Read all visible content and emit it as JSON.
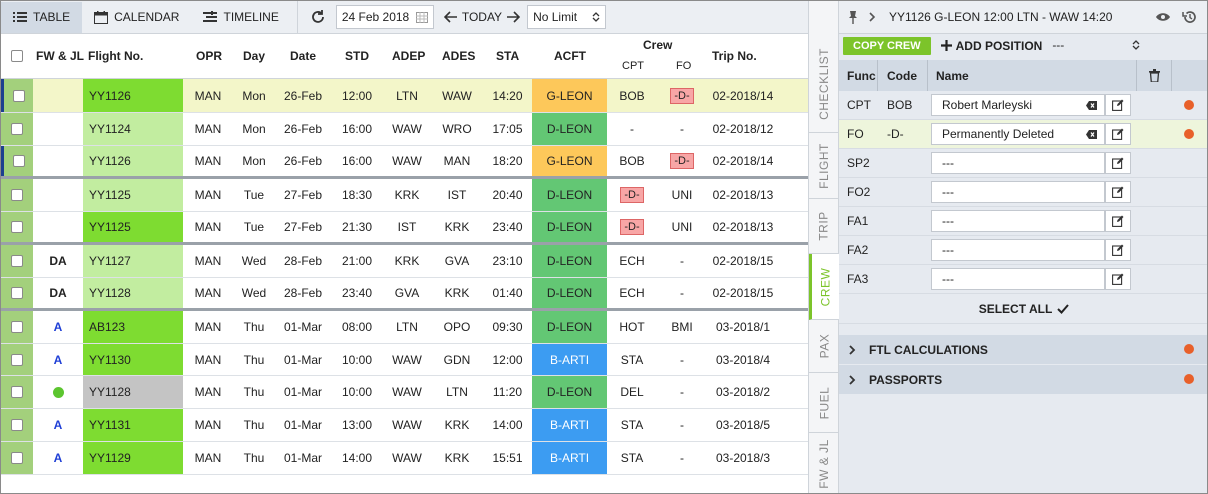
{
  "toolbar": {
    "table": "TABLE",
    "calendar": "CALENDAR",
    "timeline": "TIMELINE",
    "date": "24 Feb 2018",
    "today": "TODAY",
    "limit": "No Limit"
  },
  "columns": {
    "fwjl": "FW & JL",
    "flight": "Flight No.",
    "opr": "OPR",
    "day": "Day",
    "date": "Date",
    "std": "STD",
    "adep": "ADEP",
    "ades": "ADES",
    "sta": "STA",
    "acft": "ACFT",
    "crew": "Crew",
    "cpt": "CPT",
    "fo": "FO",
    "trip": "Trip No."
  },
  "rows": [
    {
      "fw": "",
      "flight": "YY1126",
      "opr": "MAN",
      "day": "Mon",
      "date": "26-Feb",
      "std": "12:00",
      "adep": "LTN",
      "ades": "WAW",
      "sta": "14:20",
      "acft": "G-LEON",
      "cpt": "BOB",
      "fo": "-D-",
      "trip": "02-2018/14"
    },
    {
      "fw": "",
      "flight": "YY1124",
      "opr": "MAN",
      "day": "Mon",
      "date": "26-Feb",
      "std": "16:00",
      "adep": "WAW",
      "ades": "WRO",
      "sta": "17:05",
      "acft": "D-LEON",
      "cpt": "-",
      "fo": "-",
      "trip": "02-2018/12"
    },
    {
      "fw": "",
      "flight": "YY1126",
      "opr": "MAN",
      "day": "Mon",
      "date": "26-Feb",
      "std": "16:00",
      "adep": "WAW",
      "ades": "MAN",
      "sta": "18:20",
      "acft": "G-LEON",
      "cpt": "BOB",
      "fo": "-D-",
      "trip": "02-2018/14"
    },
    {
      "fw": "",
      "flight": "YY1125",
      "opr": "MAN",
      "day": "Tue",
      "date": "27-Feb",
      "std": "18:30",
      "adep": "KRK",
      "ades": "IST",
      "sta": "20:40",
      "acft": "D-LEON",
      "cpt": "-D-",
      "fo": "UNI",
      "trip": "02-2018/13"
    },
    {
      "fw": "",
      "flight": "YY1125",
      "opr": "MAN",
      "day": "Tue",
      "date": "27-Feb",
      "std": "21:30",
      "adep": "IST",
      "ades": "KRK",
      "sta": "23:40",
      "acft": "D-LEON",
      "cpt": "-D-",
      "fo": "UNI",
      "trip": "02-2018/13"
    },
    {
      "fw": "DA",
      "flight": "YY1127",
      "opr": "MAN",
      "day": "Wed",
      "date": "28-Feb",
      "std": "21:00",
      "adep": "KRK",
      "ades": "GVA",
      "sta": "23:10",
      "acft": "D-LEON",
      "cpt": "ECH",
      "fo": "-",
      "trip": "02-2018/15"
    },
    {
      "fw": "DA",
      "flight": "YY1128",
      "opr": "MAN",
      "day": "Wed",
      "date": "28-Feb",
      "std": "23:40",
      "adep": "GVA",
      "ades": "KRK",
      "sta": "01:40",
      "acft": "D-LEON",
      "cpt": "ECH",
      "fo": "-",
      "trip": "02-2018/15"
    },
    {
      "fw": "A",
      "flight": "AB123",
      "opr": "MAN",
      "day": "Thu",
      "date": "01-Mar",
      "std": "08:00",
      "adep": "LTN",
      "ades": "OPO",
      "sta": "09:30",
      "acft": "D-LEON",
      "cpt": "HOT",
      "fo": "BMI",
      "trip": "03-2018/1"
    },
    {
      "fw": "A",
      "flight": "YY1130",
      "opr": "MAN",
      "day": "Thu",
      "date": "01-Mar",
      "std": "10:00",
      "adep": "WAW",
      "ades": "GDN",
      "sta": "12:00",
      "acft": "B-ARTI",
      "cpt": "STA",
      "fo": "-",
      "trip": "03-2018/4"
    },
    {
      "fw": "",
      "flight": "YY1128",
      "opr": "MAN",
      "day": "Thu",
      "date": "01-Mar",
      "std": "10:00",
      "adep": "WAW",
      "ades": "LTN",
      "sta": "11:20",
      "acft": "D-LEON",
      "cpt": "DEL",
      "fo": "-",
      "trip": "03-2018/2"
    },
    {
      "fw": "A",
      "flight": "YY1131",
      "opr": "MAN",
      "day": "Thu",
      "date": "01-Mar",
      "std": "13:00",
      "adep": "WAW",
      "ades": "KRK",
      "sta": "14:00",
      "acft": "B-ARTI",
      "cpt": "STA",
      "fo": "-",
      "trip": "03-2018/5"
    },
    {
      "fw": "A",
      "flight": "YY1129",
      "opr": "MAN",
      "day": "Thu",
      "date": "01-Mar",
      "std": "14:00",
      "adep": "WAW",
      "ades": "KRK",
      "sta": "15:51",
      "acft": "B-ARTI",
      "cpt": "STA",
      "fo": "-",
      "trip": "03-2018/3"
    }
  ],
  "side_tabs": [
    "CHECKLIST",
    "FLIGHT",
    "TRIP",
    "CREW",
    "PAX",
    "FUEL",
    "FW & JL"
  ],
  "panel": {
    "title": "YY1126 G-LEON 12:00 LTN - WAW 14:20",
    "copy_crew": "COPY CREW",
    "add_position": "ADD POSITION",
    "position_select": "---",
    "hdr_func": "Func",
    "hdr_code": "Code",
    "hdr_name": "Name",
    "crew": [
      {
        "func": "CPT",
        "code": "BOB",
        "name": "Robert Marleyski"
      },
      {
        "func": "FO",
        "code": "-D-",
        "name": "Permanently Deleted"
      },
      {
        "func": "SP2",
        "code": "",
        "name": "---"
      },
      {
        "func": "FO2",
        "code": "",
        "name": "---"
      },
      {
        "func": "FA1",
        "code": "",
        "name": "---"
      },
      {
        "func": "FA2",
        "code": "",
        "name": "---"
      },
      {
        "func": "FA3",
        "code": "",
        "name": "---"
      }
    ],
    "select_all": "SELECT ALL",
    "ftl": "FTL CALCULATIONS",
    "passports": "PASSPORTS"
  },
  "colors": {
    "green_dark": "#7edc31",
    "green_light": "#c2eda0",
    "gray": "#c4c4c4",
    "acft_orange": "#fdc85a",
    "acft_green": "#63c774",
    "acft_blue": "#3c9cf2",
    "accent": "#7cc42a",
    "status_dot": "#e8602a"
  }
}
